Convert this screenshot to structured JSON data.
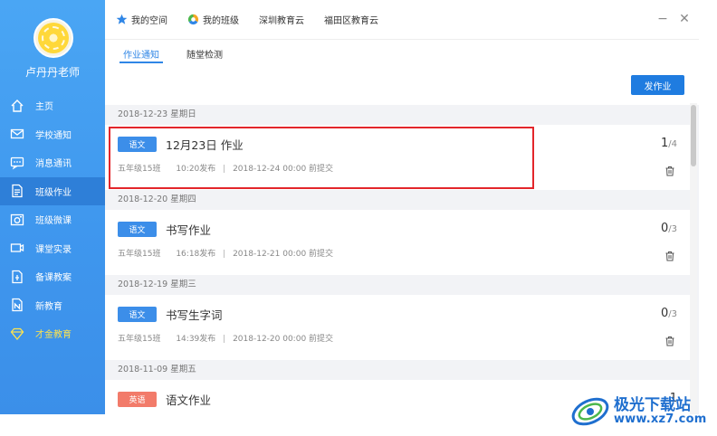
{
  "sidebar": {
    "username": "卢丹丹老师",
    "items": [
      {
        "label": "主页",
        "icon": "home-icon"
      },
      {
        "label": "学校通知",
        "icon": "mail-icon"
      },
      {
        "label": "消息通讯",
        "icon": "chat-icon"
      },
      {
        "label": "班级作业",
        "icon": "document-icon",
        "active": true
      },
      {
        "label": "班级微课",
        "icon": "camera-icon"
      },
      {
        "label": "课堂实录",
        "icon": "video-icon"
      },
      {
        "label": "备课教案",
        "icon": "lesson-plan-icon"
      },
      {
        "label": "新教育",
        "icon": "new-education-icon"
      },
      {
        "label": "才金教育",
        "icon": "diamond-icon"
      }
    ]
  },
  "topnav": {
    "items": [
      {
        "label": "我的空间",
        "icon": "star-icon"
      },
      {
        "label": "我的班级",
        "icon": "circle-icon"
      },
      {
        "label": "深圳教育云",
        "icon": ""
      },
      {
        "label": "福田区教育云",
        "icon": ""
      }
    ],
    "minimize": "−",
    "close": "✕"
  },
  "tabs": {
    "items": [
      "作业通知",
      "随堂检测"
    ]
  },
  "actions": {
    "publish_label": "发作业"
  },
  "homework": {
    "groups": [
      {
        "date": "2018-12-23 星期日",
        "items": [
          {
            "subject": "语文",
            "subject_color": "#3c8ee9",
            "title": "12月23日 作业",
            "class": "五年级15班",
            "published": "10:20发布",
            "deadline": "2018-12-24 00:00 前提交",
            "done": "1",
            "total": "/4"
          }
        ]
      },
      {
        "date": "2018-12-20 星期四",
        "items": [
          {
            "subject": "语文",
            "subject_color": "#3c8ee9",
            "title": "书写作业",
            "class": "五年级15班",
            "published": "16:18发布",
            "deadline": "2018-12-21 00:00 前提交",
            "done": "0",
            "total": "/3"
          }
        ]
      },
      {
        "date": "2018-12-19 星期三",
        "items": [
          {
            "subject": "语文",
            "subject_color": "#3c8ee9",
            "title": "书写生字词",
            "class": "五年级15班",
            "published": "14:39发布",
            "deadline": "2018-12-20 00:00 前提交",
            "done": "0",
            "total": "/3"
          }
        ]
      },
      {
        "date": "2018-11-09 星期五",
        "items": [
          {
            "subject": "英语",
            "subject_color": "#f27b6a",
            "title": "语文作业",
            "done": "1",
            "total": ""
          }
        ]
      }
    ]
  },
  "watermark": {
    "name": "极光下载站",
    "url": "www.xz7.com"
  },
  "colors": {
    "sidebar": "#4aa6f4",
    "sidebar_active": "#2e7fd8",
    "accent": "#1f7ce0",
    "highlight": "#e3262b",
    "subject_blue": "#3c8ee9",
    "subject_red": "#f27b6a"
  }
}
